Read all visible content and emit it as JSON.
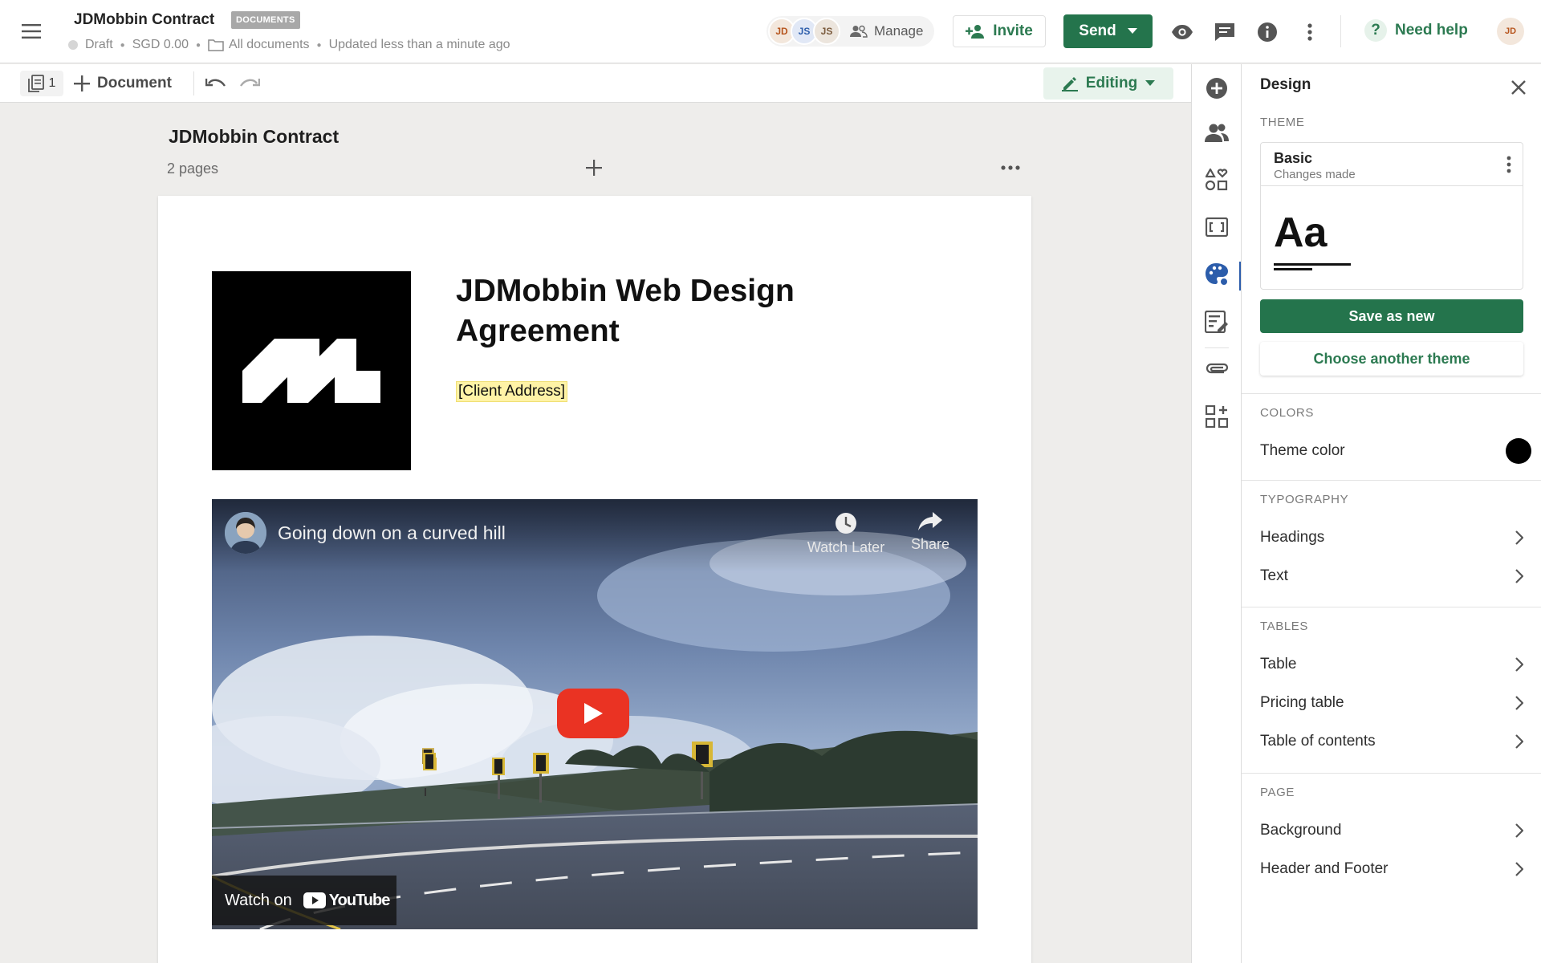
{
  "header": {
    "doc_title": "JDMobbin Contract",
    "badge": "DOCUMENTS",
    "status": "Draft",
    "amount": "SGD 0.00",
    "folder": "All documents",
    "updated": "Updated less than a minute ago",
    "avatars": [
      "JD",
      "JS",
      "JS"
    ],
    "manage_label": "Manage",
    "invite_label": "Invite",
    "send_label": "Send",
    "help_label": "Need help",
    "user_initials": "JD"
  },
  "toolbar": {
    "page_count": "1",
    "add_document_label": "Document",
    "mode_label": "Editing"
  },
  "canvas": {
    "title": "JDMobbin Contract",
    "pages": "2 pages"
  },
  "document": {
    "heading": "JDMobbin Web Design Agreement",
    "client_address_placeholder": "[Client Address]",
    "video": {
      "title": "Going down on a curved hill",
      "watch_later": "Watch Later",
      "share": "Share",
      "watch_on": "Watch on",
      "brand": "YouTube"
    }
  },
  "rail": {
    "icons": [
      "add-icon",
      "recipients-icon",
      "content-blocks-icon",
      "variables-icon",
      "design-icon",
      "forms-icon",
      "attachments-icon",
      "apps-icon"
    ]
  },
  "design_panel": {
    "title": "Design",
    "theme_section": "THEME",
    "theme_name": "Basic",
    "theme_status": "Changes made",
    "theme_preview": "Aa",
    "save_as_new": "Save as new",
    "choose_theme": "Choose another theme",
    "colors_section": "COLORS",
    "theme_color_label": "Theme color",
    "theme_color_value": "#000000",
    "typography_section": "TYPOGRAPHY",
    "typography_items": [
      "Headings",
      "Text"
    ],
    "tables_section": "TABLES",
    "tables_items": [
      "Table",
      "Pricing table",
      "Table of contents"
    ],
    "page_section": "PAGE",
    "page_items": [
      "Background",
      "Header and Footer"
    ]
  },
  "colors": {
    "accent_green": "#24744c",
    "link_green": "#2c7a51",
    "highlight_yellow": "#fff3a6",
    "active_blue": "#2c5dab"
  }
}
